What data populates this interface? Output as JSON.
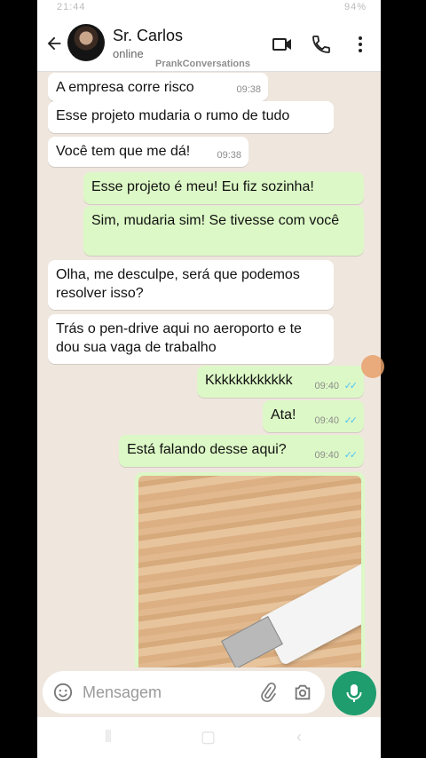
{
  "status_bar": {
    "time": "21:44",
    "right": "94%"
  },
  "header": {
    "contact_name": "Sr. Carlos",
    "contact_status": "online",
    "watermark": "PrankConversations"
  },
  "messages": [
    {
      "dir": "in",
      "text": "A empresa corre risco",
      "time": "09:38"
    },
    {
      "dir": "in",
      "text": "Esse projeto mudaria o rumo de tudo",
      "time": ""
    },
    {
      "dir": "in",
      "text": "Você tem que me dá!",
      "time": "09:38"
    },
    {
      "dir": "out",
      "text": "Esse projeto é meu! Eu fiz sozinha!",
      "time": ""
    },
    {
      "dir": "out",
      "text": "Sim, mudaria sim! Se tivesse com você",
      "time": ""
    },
    {
      "dir": "in",
      "text": "Olha, me desculpe, será que podemos resolver isso?",
      "time": ""
    },
    {
      "dir": "in",
      "text": "Trás o pen-drive aqui no aeroporto e te dou sua vaga de trabalho",
      "time": ""
    },
    {
      "dir": "out",
      "text": "Kkkkkkkkkkkk",
      "time": "09:40"
    },
    {
      "dir": "out",
      "text": "Ata!",
      "time": "09:40"
    },
    {
      "dir": "out",
      "text": "Está falando desse aqui?",
      "time": "09:40"
    }
  ],
  "input": {
    "placeholder": "Mensagem"
  },
  "colors": {
    "accent": "#1f9d6f",
    "outgoing": "#dcf8c6",
    "incoming": "#ffffff",
    "chat_bg": "#efe7de",
    "read_ticks": "#4fc3f7"
  }
}
